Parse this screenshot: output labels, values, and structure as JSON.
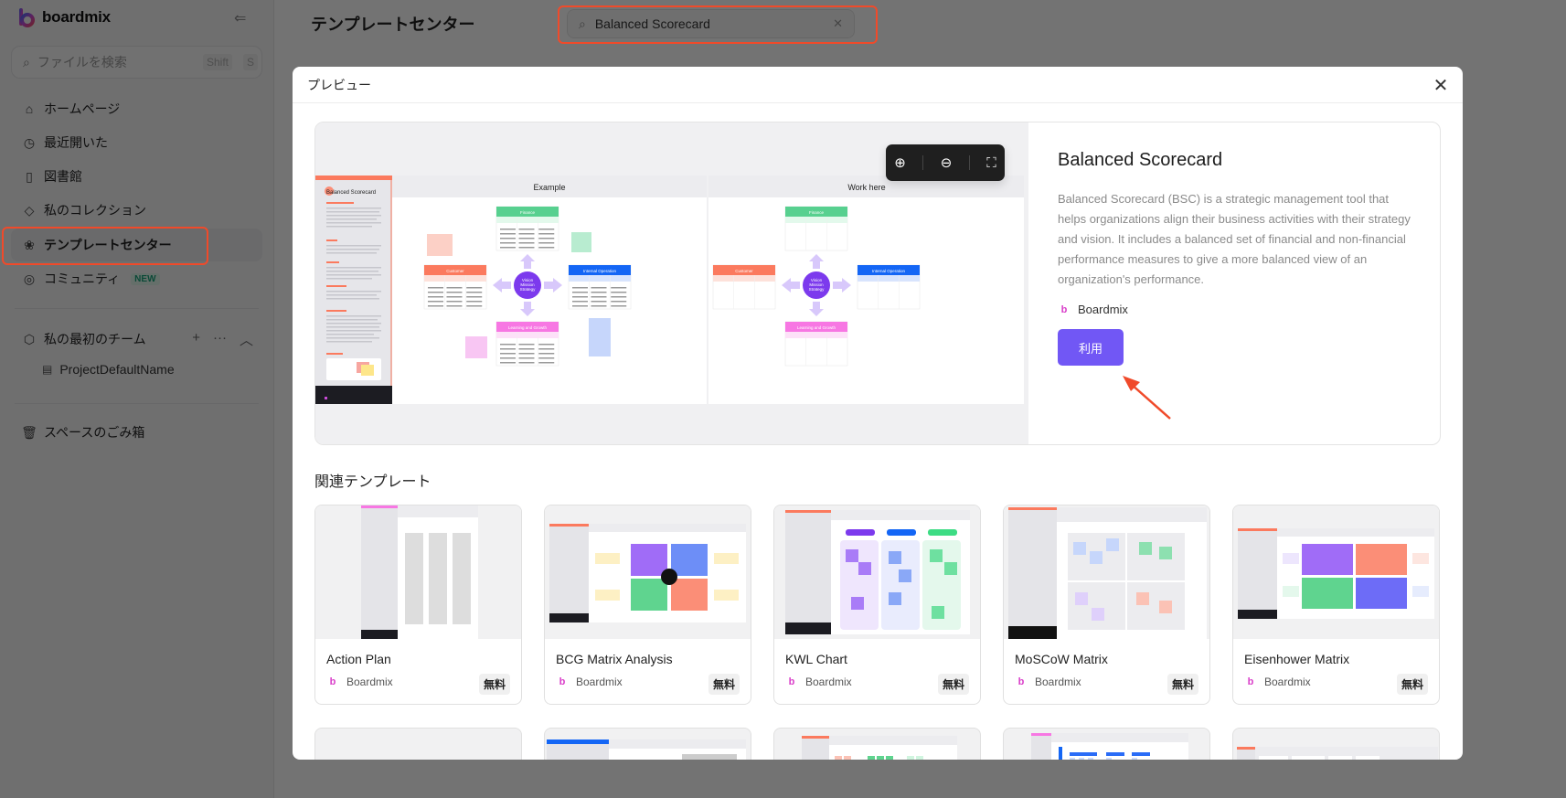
{
  "app": {
    "brand": "boardmix"
  },
  "sidebar": {
    "search": {
      "placeholder": "ファイルを検索",
      "shortcut_1": "Shift",
      "shortcut_2": "S"
    },
    "items": [
      {
        "label": "ホームページ",
        "icon": "home-icon"
      },
      {
        "label": "最近開いた",
        "icon": "clock-icon"
      },
      {
        "label": "図書館",
        "icon": "library-icon"
      },
      {
        "label": "私のコレクション",
        "icon": "tag-icon"
      },
      {
        "label": "テンプレートセンター",
        "icon": "template-icon",
        "active": true
      },
      {
        "label": "コミュニティ",
        "icon": "planet-icon",
        "badge": "NEW"
      }
    ],
    "team": {
      "label": "私の最初のチーム",
      "project": "ProjectDefaultName"
    },
    "trash": {
      "label": "スペースのごみ箱"
    }
  },
  "main": {
    "title": "テンプレートセンター",
    "search_value": "Balanced Scorecard"
  },
  "modal": {
    "title": "プレビュー",
    "preview": {
      "panels": [
        "Example",
        "Work here"
      ],
      "sidebar_title": "Balanced Scorecard",
      "center_label": "Vision Mission Strategy",
      "quadrants": [
        "Finance",
        "Customer",
        "Internal Operation",
        "Learning and Growth"
      ]
    },
    "template": {
      "name": "Balanced Scorecard",
      "description": "Balanced Scorecard (BSC) is a strategic management tool that helps organizations align their business activities with their strategy and vision. It includes a balanced set of financial and non-financial performance measures to give a more balanced view of an organization's performance.",
      "author": "Boardmix",
      "use_label": "利用"
    },
    "related_title": "関連テンプレート",
    "related": [
      {
        "name": "Action Plan",
        "author": "Boardmix",
        "price": "無料"
      },
      {
        "name": "BCG Matrix Analysis",
        "author": "Boardmix",
        "price": "無料"
      },
      {
        "name": "KWL Chart",
        "author": "Boardmix",
        "price": "無料"
      },
      {
        "name": "MoSCoW Matrix",
        "author": "Boardmix",
        "price": "無料"
      },
      {
        "name": "Eisenhower Matrix",
        "author": "Boardmix",
        "price": "無料"
      }
    ]
  },
  "colors": {
    "accent": "#7157f5",
    "highlight": "#f04a2a",
    "finance": "#57d08f",
    "customer": "#fb7a5e",
    "internal": "#1466f5",
    "learning": "#f777e3",
    "center": "#7c3aed"
  }
}
